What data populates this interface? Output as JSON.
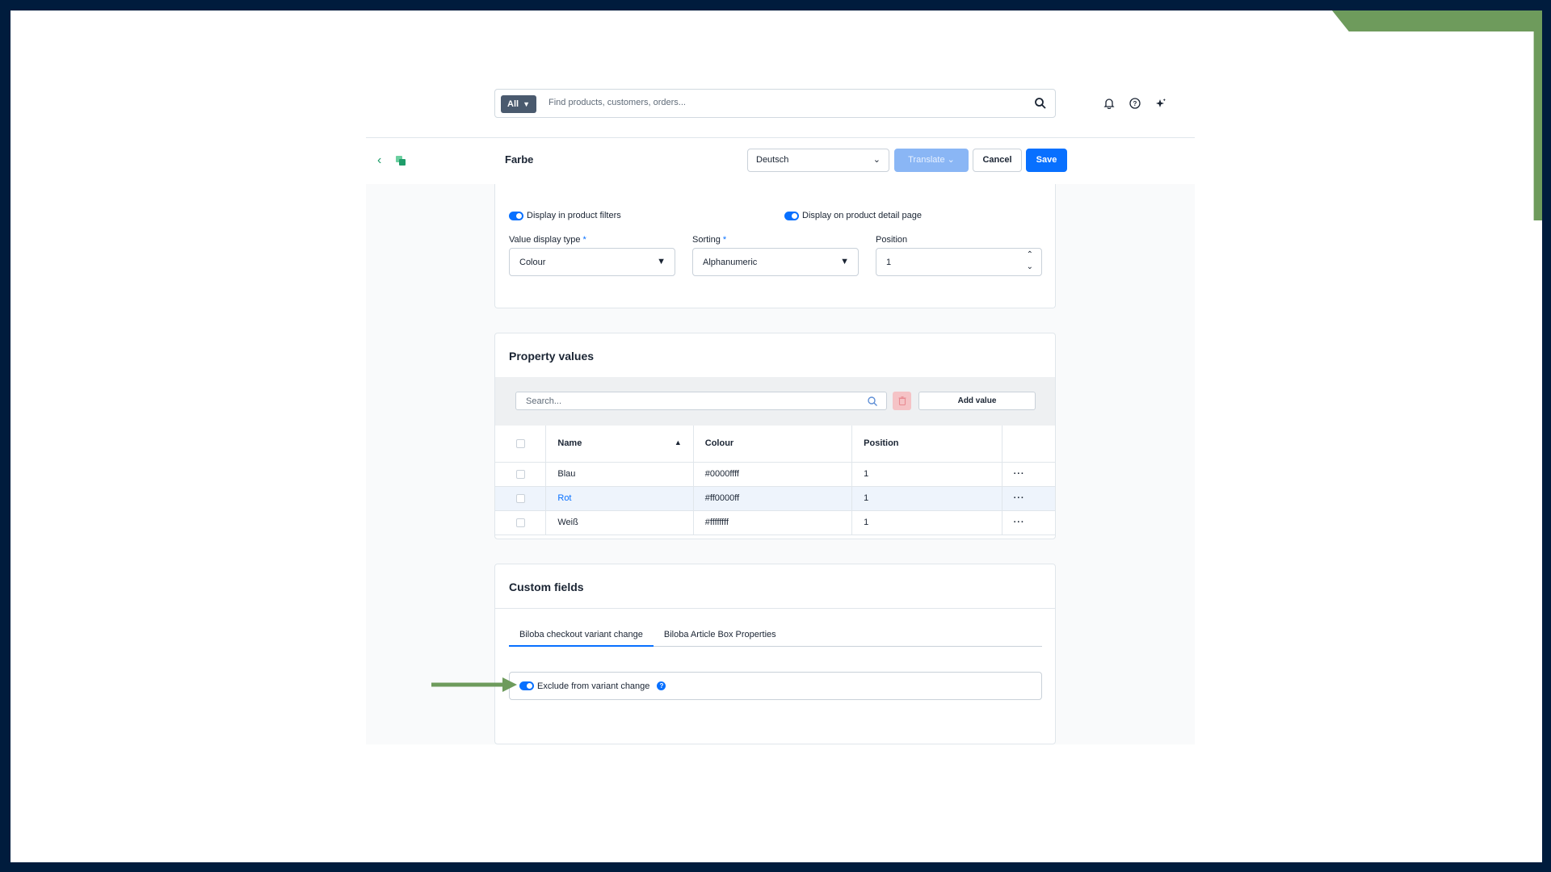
{
  "theme": {
    "accent": "#0870ff",
    "frame": "#001c3d",
    "annotation": "#6e9b5c",
    "logo_green": "#1f9d6a"
  },
  "search": {
    "filter_label": "All",
    "placeholder": "Find products, customers, orders..."
  },
  "top_icons": [
    "bell-icon",
    "help-circle-icon",
    "sparkle-icon"
  ],
  "smartbar": {
    "title": "Farbe",
    "language": "Deutsch",
    "translate_label": "Translate",
    "cancel_label": "Cancel",
    "save_label": "Save"
  },
  "settings": {
    "display_filters_label": "Display in product filters",
    "display_detail_label": "Display on product detail page",
    "value_display_type": {
      "label": "Value display type",
      "required_mark": "*",
      "value": "Colour"
    },
    "sorting": {
      "label": "Sorting",
      "required_mark": "*",
      "value": "Alphanumeric"
    },
    "position": {
      "label": "Position",
      "value": "1"
    }
  },
  "property_values": {
    "title": "Property values",
    "search_placeholder": "Search...",
    "add_value_label": "Add value",
    "columns": [
      "Name",
      "Colour",
      "Position"
    ],
    "rows": [
      {
        "name": "Blau",
        "colour": "#0000ffff",
        "position": "1"
      },
      {
        "name": "Rot",
        "colour": "#ff0000ff",
        "position": "1"
      },
      {
        "name": "Weiß",
        "colour": "#ffffffff",
        "position": "1"
      }
    ],
    "more_label": "···"
  },
  "custom_fields": {
    "title": "Custom fields",
    "tabs": [
      "Biloba checkout variant change",
      "Biloba Article Box Properties"
    ],
    "exclude_label": "Exclude from variant change",
    "help_label": "?"
  }
}
